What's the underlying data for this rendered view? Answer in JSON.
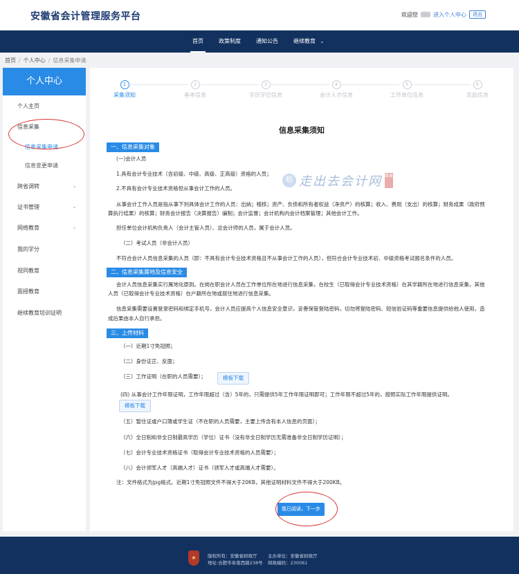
{
  "header": {
    "site_title": "安徽省会计管理服务平台",
    "welcome": "欢迎您",
    "profile_link": "进入个人中心",
    "logout": "退出"
  },
  "nav": {
    "items": [
      "首页",
      "政策制度",
      "通知公告",
      "继续教育"
    ],
    "active_index": 0
  },
  "breadcrumb": [
    "首页",
    "个人中心",
    "信息采集申请"
  ],
  "sidebar": {
    "title": "个人中心",
    "items": [
      {
        "label": "个人主页"
      },
      {
        "label": "信息采集"
      },
      {
        "label": "信息采集申请",
        "active": true
      },
      {
        "label": "信息变更申请"
      },
      {
        "label": "跨省调转",
        "caret": true
      },
      {
        "label": "证书管理",
        "caret": true
      },
      {
        "label": "网络教育",
        "caret": true
      },
      {
        "label": "我的学分"
      },
      {
        "label": "视同教育"
      },
      {
        "label": "面授教育"
      },
      {
        "label": "继续教育培训证明"
      }
    ]
  },
  "steps": [
    {
      "num": "1",
      "label": "采集须知",
      "active": true
    },
    {
      "num": "2",
      "label": "基本信息"
    },
    {
      "num": "3",
      "label": "学历学位信息"
    },
    {
      "num": "4",
      "label": "会计人才信息"
    },
    {
      "num": "5",
      "label": "工作单位信息"
    },
    {
      "num": "6",
      "label": "奖励信息"
    }
  ],
  "notice": {
    "title": "信息采集须知",
    "sec1": "一、信息采集对象",
    "sec1_lines": [
      "(一)会计人员",
      "1.具有会计专业技术（含初级、中级、高级、正高级）资格的人员；",
      "2.不具有会计专业技术资格但从事会计工作的人员。",
      "从事会计工作人员是指从事下列具体会计工作的人员：出纳；稽核；资产、负债和所有者权益（净资产）的核算；收入、费用（支出）的核算；财务成果（政府预",
      "算执行结果）的核算；财务会计报告（决算报告）编制；会计监督；会计机构内会计档案管理；其他会计工作。",
      "担任单位会计机构负责人（会计主管人员）、总会计师的人员，属于会计人员。",
      "（二）考试人员（非会计人员）",
      "不符合会计人员信息采集的人员（即：不具有会计专业技术资格且不从事会计工作的人员），但符合会计专业技术初、中级资格考试报名条件的人员。"
    ],
    "sec2": "二、信息采集属地及信息安全",
    "sec2_lines": [
      "会计人员信息采集实行属地化原则。在岗在职会计人员在工作单位所在地进行信息采集，在校生（已取得会计专业技术资格）在其学籍所在地进行信息采集，其他",
      "人员（已取得会计专业技术资格）在户籍所在地或居住地进行信息采集。",
      "信息采集需要设置登录密码和绑定手机号，会计人员应提高个人信息安全意识，妥善保管登陆密码，切勿将登陆密码、短信验证码等重要信息提供给他人使用，造",
      "成后果由本人自行承担。"
    ],
    "sec3": "三、上传材料",
    "sec3_lines": [
      "（一）近期1寸免冠照；",
      "（二）身份证正、反面；",
      "（三）工作证明（在职的人员需要）；",
      "(四) 从事会计工作年限证明，工作年限超过（含）5年的，只需提供5年工作年限证明即可；工作年限不超过5年的，按照实际工作年限提供证明。",
      "（五）暂住证或户口簿或学生证（不在职的人员需要，主要上传含有本人信息的页面）；",
      "（六）全日制和非全日制最高学历（学位）证书（没有非全日制学历无需准备非全日制学历证明）；",
      "（七）会计专业技术资格证书（取得会计专业技术资格的人员需要）；",
      "（八）会计领军人才（高端人才）证书（领军人才或高端人才需要）。",
      "注：文件格式为jpg格式。近期1寸免冠照文件不得大于20KB，其他证明材料文件不得大于200KB。"
    ],
    "template_btn": "模板下载",
    "next_btn": "我已阅读，下一步"
  },
  "watermark": {
    "logo_char": "稻",
    "text": "走出去会计网",
    "seal": "版本"
  },
  "footer": {
    "emblem_char": "★",
    "sponsor": "版权所有：安徽省财政厅",
    "organizer": "主办单位：安徽省财政厅",
    "address": "地址:合肥市阜南西路238号",
    "postcode": "邮政编码：230061"
  },
  "colors": {
    "brand_navy": "#12315f",
    "accent_blue": "#2a8be6",
    "annotation_red": "#d33"
  }
}
